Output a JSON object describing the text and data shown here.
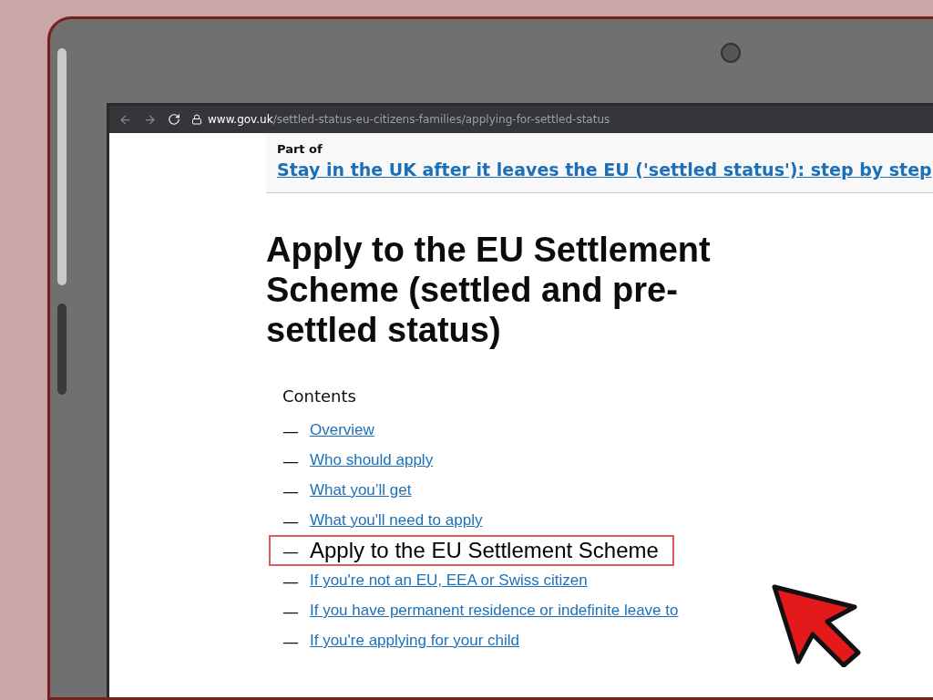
{
  "browser": {
    "url_domain": "www.gov.uk",
    "url_path": "/settled-status-eu-citizens-families/applying-for-settled-status"
  },
  "part_of": {
    "label": "Part of",
    "link": "Stay in the UK after it leaves the EU ('settled status'): step by step"
  },
  "title": "Apply to the EU Settlement Scheme (settled and pre-settled status)",
  "contents": {
    "heading": "Contents",
    "items": [
      {
        "dash": "—",
        "label": "Overview",
        "selected": false
      },
      {
        "dash": "—",
        "label": "Who should apply",
        "selected": false
      },
      {
        "dash": "—",
        "label": "What you’ll get",
        "selected": false
      },
      {
        "dash": "—",
        "label": "What you'll need to apply",
        "selected": false
      },
      {
        "dash": "—",
        "label": "Apply to the EU Settlement Scheme",
        "selected": true
      },
      {
        "dash": "—",
        "label": "If you're not an EU, EEA or Swiss citizen",
        "selected": false
      },
      {
        "dash": "—",
        "label": "If you have permanent residence or indefinite leave to",
        "selected": false
      },
      {
        "dash": "—",
        "label": "If you're applying for your child",
        "selected": false
      }
    ]
  }
}
